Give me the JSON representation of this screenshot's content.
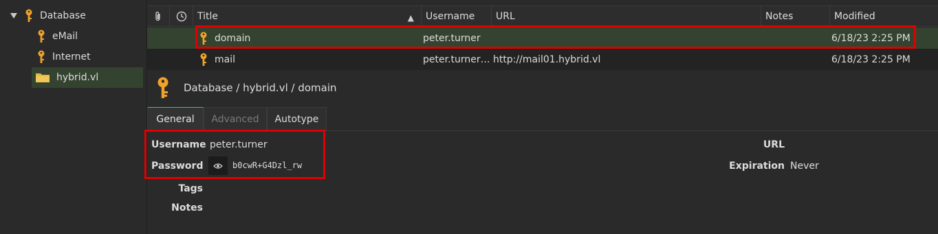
{
  "sidebar": {
    "root": {
      "label": "Database",
      "icon": "key-icon"
    },
    "items": [
      {
        "label": "eMail",
        "icon": "key-icon"
      },
      {
        "label": "Internet",
        "icon": "key-icon"
      },
      {
        "label": "hybrid.vl",
        "icon": "folder-icon",
        "selected": true
      }
    ]
  },
  "table": {
    "columns": [
      "Title",
      "Username",
      "URL",
      "Notes",
      "Modified"
    ],
    "sort_indicator": "▲",
    "rows": [
      {
        "title": "domain",
        "username": "peter.turner",
        "url": "",
        "notes": "",
        "modified": "6/18/23 2:25 PM",
        "selected": true
      },
      {
        "title": "mail",
        "username": "peter.turner…",
        "url": "http://mail01.hybrid.vl",
        "notes": "",
        "modified": "6/18/23 2:25 PM",
        "selected": false
      }
    ]
  },
  "breadcrumb": "Database / hybrid.vl / domain",
  "tabs": [
    {
      "label": "General",
      "state": "active"
    },
    {
      "label": "Advanced",
      "state": "disabled"
    },
    {
      "label": "Autotype",
      "state": "normal"
    }
  ],
  "details": {
    "username_label": "Username",
    "username_value": "peter.turner",
    "password_label": "Password",
    "password_value": "b0cwR+G4Dzl_rw",
    "tags_label": "Tags",
    "notes_label": "Notes",
    "url_label": "URL",
    "expiration_label": "Expiration",
    "expiration_value": "Never"
  },
  "colors": {
    "key_icon": "#f0a22a",
    "folder_icon": "#e4b84a",
    "selection": "#34432f",
    "highlight_box": "#e00000"
  }
}
